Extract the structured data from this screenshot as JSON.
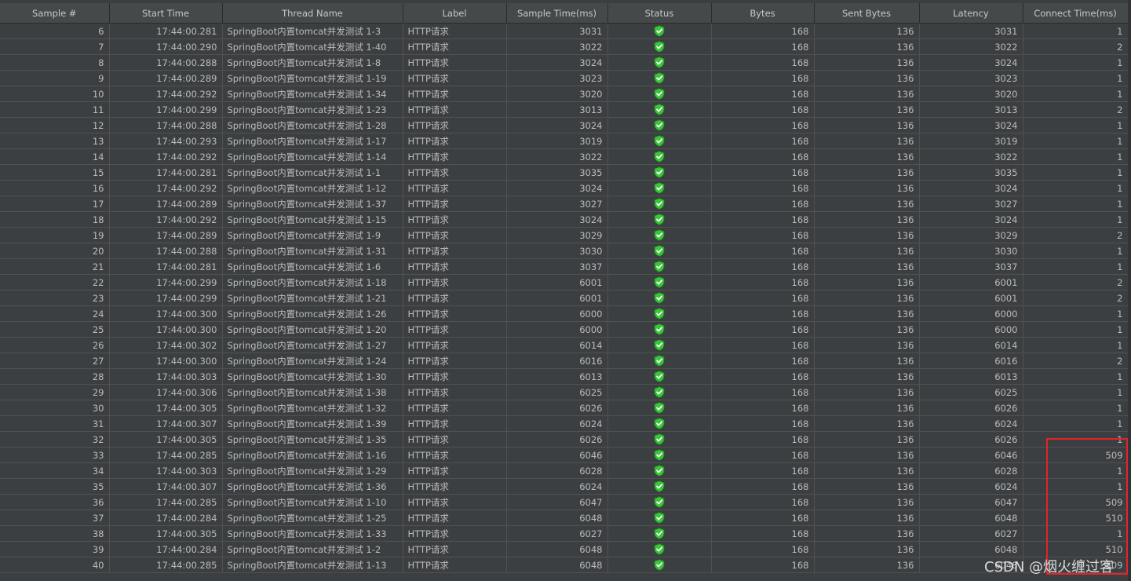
{
  "columns": [
    "Sample #",
    "Start Time",
    "Thread Name",
    "Label",
    "Sample Time(ms)",
    "Status",
    "Bytes",
    "Sent Bytes",
    "Latency",
    "Connect Time(ms)"
  ],
  "status_icon": "success-shield-icon",
  "rows": [
    {
      "sample": "6",
      "start": "17:44:00.281",
      "thread": "SpringBoot内置tomcat并发测试 1-3",
      "label": "HTTP请求",
      "time": "3031",
      "bytes": "168",
      "sent": "136",
      "latency": "3031",
      "connect": "1"
    },
    {
      "sample": "7",
      "start": "17:44:00.290",
      "thread": "SpringBoot内置tomcat并发测试 1-40",
      "label": "HTTP请求",
      "time": "3022",
      "bytes": "168",
      "sent": "136",
      "latency": "3022",
      "connect": "2"
    },
    {
      "sample": "8",
      "start": "17:44:00.288",
      "thread": "SpringBoot内置tomcat并发测试 1-8",
      "label": "HTTP请求",
      "time": "3024",
      "bytes": "168",
      "sent": "136",
      "latency": "3024",
      "connect": "1"
    },
    {
      "sample": "9",
      "start": "17:44:00.289",
      "thread": "SpringBoot内置tomcat并发测试 1-19",
      "label": "HTTP请求",
      "time": "3023",
      "bytes": "168",
      "sent": "136",
      "latency": "3023",
      "connect": "1"
    },
    {
      "sample": "10",
      "start": "17:44:00.292",
      "thread": "SpringBoot内置tomcat并发测试 1-34",
      "label": "HTTP请求",
      "time": "3020",
      "bytes": "168",
      "sent": "136",
      "latency": "3020",
      "connect": "1"
    },
    {
      "sample": "11",
      "start": "17:44:00.299",
      "thread": "SpringBoot内置tomcat并发测试 1-23",
      "label": "HTTP请求",
      "time": "3013",
      "bytes": "168",
      "sent": "136",
      "latency": "3013",
      "connect": "2"
    },
    {
      "sample": "12",
      "start": "17:44:00.288",
      "thread": "SpringBoot内置tomcat并发测试 1-28",
      "label": "HTTP请求",
      "time": "3024",
      "bytes": "168",
      "sent": "136",
      "latency": "3024",
      "connect": "1"
    },
    {
      "sample": "13",
      "start": "17:44:00.293",
      "thread": "SpringBoot内置tomcat并发测试 1-17",
      "label": "HTTP请求",
      "time": "3019",
      "bytes": "168",
      "sent": "136",
      "latency": "3019",
      "connect": "1"
    },
    {
      "sample": "14",
      "start": "17:44:00.292",
      "thread": "SpringBoot内置tomcat并发测试 1-14",
      "label": "HTTP请求",
      "time": "3022",
      "bytes": "168",
      "sent": "136",
      "latency": "3022",
      "connect": "1"
    },
    {
      "sample": "15",
      "start": "17:44:00.281",
      "thread": "SpringBoot内置tomcat并发测试 1-1",
      "label": "HTTP请求",
      "time": "3035",
      "bytes": "168",
      "sent": "136",
      "latency": "3035",
      "connect": "1"
    },
    {
      "sample": "16",
      "start": "17:44:00.292",
      "thread": "SpringBoot内置tomcat并发测试 1-12",
      "label": "HTTP请求",
      "time": "3024",
      "bytes": "168",
      "sent": "136",
      "latency": "3024",
      "connect": "1"
    },
    {
      "sample": "17",
      "start": "17:44:00.289",
      "thread": "SpringBoot内置tomcat并发测试 1-37",
      "label": "HTTP请求",
      "time": "3027",
      "bytes": "168",
      "sent": "136",
      "latency": "3027",
      "connect": "1"
    },
    {
      "sample": "18",
      "start": "17:44:00.292",
      "thread": "SpringBoot内置tomcat并发测试 1-15",
      "label": "HTTP请求",
      "time": "3024",
      "bytes": "168",
      "sent": "136",
      "latency": "3024",
      "connect": "1"
    },
    {
      "sample": "19",
      "start": "17:44:00.289",
      "thread": "SpringBoot内置tomcat并发测试 1-9",
      "label": "HTTP请求",
      "time": "3029",
      "bytes": "168",
      "sent": "136",
      "latency": "3029",
      "connect": "2"
    },
    {
      "sample": "20",
      "start": "17:44:00.288",
      "thread": "SpringBoot内置tomcat并发测试 1-31",
      "label": "HTTP请求",
      "time": "3030",
      "bytes": "168",
      "sent": "136",
      "latency": "3030",
      "connect": "1"
    },
    {
      "sample": "21",
      "start": "17:44:00.281",
      "thread": "SpringBoot内置tomcat并发测试 1-6",
      "label": "HTTP请求",
      "time": "3037",
      "bytes": "168",
      "sent": "136",
      "latency": "3037",
      "connect": "1"
    },
    {
      "sample": "22",
      "start": "17:44:00.299",
      "thread": "SpringBoot内置tomcat并发测试 1-18",
      "label": "HTTP请求",
      "time": "6001",
      "bytes": "168",
      "sent": "136",
      "latency": "6001",
      "connect": "2"
    },
    {
      "sample": "23",
      "start": "17:44:00.299",
      "thread": "SpringBoot内置tomcat并发测试 1-21",
      "label": "HTTP请求",
      "time": "6001",
      "bytes": "168",
      "sent": "136",
      "latency": "6001",
      "connect": "2"
    },
    {
      "sample": "24",
      "start": "17:44:00.300",
      "thread": "SpringBoot内置tomcat并发测试 1-26",
      "label": "HTTP请求",
      "time": "6000",
      "bytes": "168",
      "sent": "136",
      "latency": "6000",
      "connect": "1"
    },
    {
      "sample": "25",
      "start": "17:44:00.300",
      "thread": "SpringBoot内置tomcat并发测试 1-20",
      "label": "HTTP请求",
      "time": "6000",
      "bytes": "168",
      "sent": "136",
      "latency": "6000",
      "connect": "1"
    },
    {
      "sample": "26",
      "start": "17:44:00.302",
      "thread": "SpringBoot内置tomcat并发测试 1-27",
      "label": "HTTP请求",
      "time": "6014",
      "bytes": "168",
      "sent": "136",
      "latency": "6014",
      "connect": "1"
    },
    {
      "sample": "27",
      "start": "17:44:00.300",
      "thread": "SpringBoot内置tomcat并发测试 1-24",
      "label": "HTTP请求",
      "time": "6016",
      "bytes": "168",
      "sent": "136",
      "latency": "6016",
      "connect": "2"
    },
    {
      "sample": "28",
      "start": "17:44:00.303",
      "thread": "SpringBoot内置tomcat并发测试 1-30",
      "label": "HTTP请求",
      "time": "6013",
      "bytes": "168",
      "sent": "136",
      "latency": "6013",
      "connect": "1"
    },
    {
      "sample": "29",
      "start": "17:44:00.306",
      "thread": "SpringBoot内置tomcat并发测试 1-38",
      "label": "HTTP请求",
      "time": "6025",
      "bytes": "168",
      "sent": "136",
      "latency": "6025",
      "connect": "1"
    },
    {
      "sample": "30",
      "start": "17:44:00.305",
      "thread": "SpringBoot内置tomcat并发测试 1-32",
      "label": "HTTP请求",
      "time": "6026",
      "bytes": "168",
      "sent": "136",
      "latency": "6026",
      "connect": "1"
    },
    {
      "sample": "31",
      "start": "17:44:00.307",
      "thread": "SpringBoot内置tomcat并发测试 1-39",
      "label": "HTTP请求",
      "time": "6024",
      "bytes": "168",
      "sent": "136",
      "latency": "6024",
      "connect": "1"
    },
    {
      "sample": "32",
      "start": "17:44:00.305",
      "thread": "SpringBoot内置tomcat并发测试 1-35",
      "label": "HTTP请求",
      "time": "6026",
      "bytes": "168",
      "sent": "136",
      "latency": "6026",
      "connect": "1"
    },
    {
      "sample": "33",
      "start": "17:44:00.285",
      "thread": "SpringBoot内置tomcat并发测试 1-16",
      "label": "HTTP请求",
      "time": "6046",
      "bytes": "168",
      "sent": "136",
      "latency": "6046",
      "connect": "509"
    },
    {
      "sample": "34",
      "start": "17:44:00.303",
      "thread": "SpringBoot内置tomcat并发测试 1-29",
      "label": "HTTP请求",
      "time": "6028",
      "bytes": "168",
      "sent": "136",
      "latency": "6028",
      "connect": "1"
    },
    {
      "sample": "35",
      "start": "17:44:00.307",
      "thread": "SpringBoot内置tomcat并发测试 1-36",
      "label": "HTTP请求",
      "time": "6024",
      "bytes": "168",
      "sent": "136",
      "latency": "6024",
      "connect": "1"
    },
    {
      "sample": "36",
      "start": "17:44:00.285",
      "thread": "SpringBoot内置tomcat并发测试 1-10",
      "label": "HTTP请求",
      "time": "6047",
      "bytes": "168",
      "sent": "136",
      "latency": "6047",
      "connect": "509"
    },
    {
      "sample": "37",
      "start": "17:44:00.284",
      "thread": "SpringBoot内置tomcat并发测试 1-25",
      "label": "HTTP请求",
      "time": "6048",
      "bytes": "168",
      "sent": "136",
      "latency": "6048",
      "connect": "510"
    },
    {
      "sample": "38",
      "start": "17:44:00.305",
      "thread": "SpringBoot内置tomcat并发测试 1-33",
      "label": "HTTP请求",
      "time": "6027",
      "bytes": "168",
      "sent": "136",
      "latency": "6027",
      "connect": "1"
    },
    {
      "sample": "39",
      "start": "17:44:00.284",
      "thread": "SpringBoot内置tomcat并发测试 1-2",
      "label": "HTTP请求",
      "time": "6048",
      "bytes": "168",
      "sent": "136",
      "latency": "6048",
      "connect": "510"
    },
    {
      "sample": "40",
      "start": "17:44:00.285",
      "thread": "SpringBoot内置tomcat并发测试 1-13",
      "label": "HTTP请求",
      "time": "6048",
      "bytes": "168",
      "sent": "136",
      "latency": "6048",
      "connect": "509"
    }
  ],
  "watermark": "CSDN @烟火缠过客",
  "colors": {
    "highlight": "#e0242b",
    "status_ok": "#3cc43c"
  }
}
